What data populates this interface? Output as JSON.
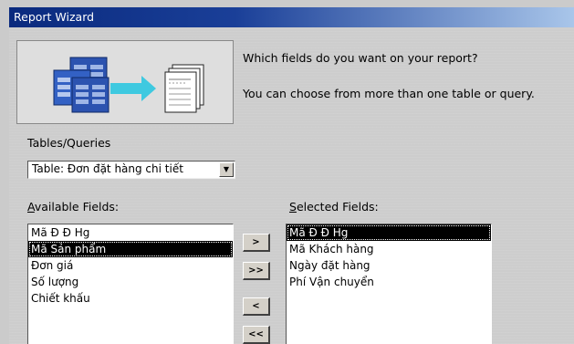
{
  "window": {
    "title": "Report Wizard"
  },
  "prompt": {
    "question": "Which fields do you want on your report?",
    "hint": "You can choose from more than one table or query."
  },
  "tables_queries": {
    "label": "Tables/Queries",
    "selected_value": "Table: Đơn đặt hàng chi tiết"
  },
  "available": {
    "label_accel": "A",
    "label_rest": "vailable Fields:",
    "items": [
      "Mã Đ Đ Hg",
      "Mã Sản phẩm",
      "Đơn giá",
      "Số lượng",
      "Chiết khấu"
    ],
    "selected_index": 1
  },
  "selected": {
    "label_accel": "S",
    "label_rest": "elected Fields:",
    "items": [
      "Mã Đ Đ Hg",
      "Mã Khách hàng",
      "Ngày đặt hàng",
      "Phí Vận chuyển"
    ],
    "selected_index": 0
  },
  "buttons": {
    "add_one": ">",
    "add_all": ">>",
    "remove_one": "<",
    "remove_all": "<<"
  },
  "icons": {
    "wizard_picture": "tables-to-report-icon",
    "dropdown": "chevron-down-icon"
  }
}
